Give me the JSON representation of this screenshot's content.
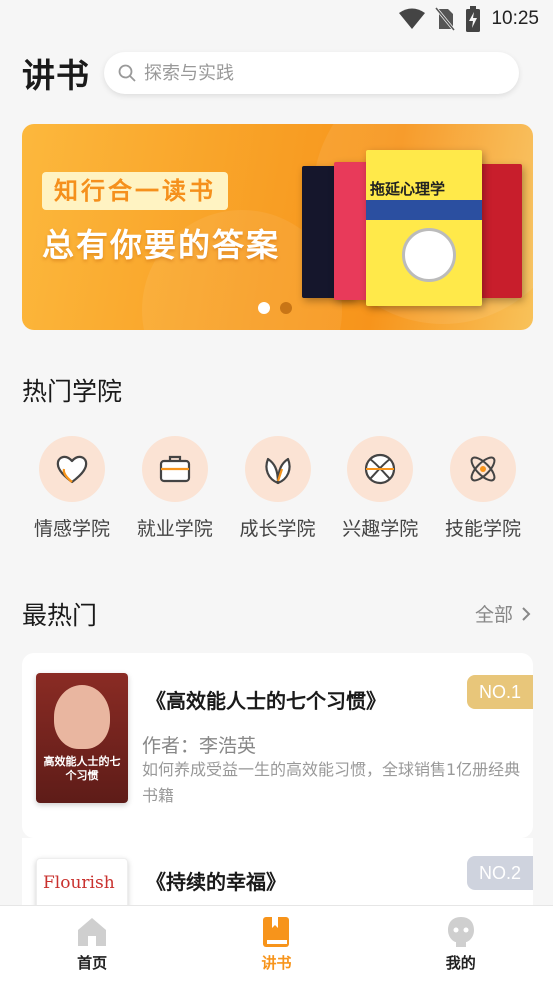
{
  "status_bar": {
    "time": "10:25"
  },
  "header": {
    "title": "讲书",
    "search_placeholder": "探索与实践"
  },
  "banner": {
    "line1": "知行合一读书",
    "line2": "总有你要的答案",
    "book_title": "拖延心理学",
    "slide_count": 2,
    "active_slide": 1
  },
  "hot_academies": {
    "title": "热门学院",
    "items": [
      {
        "label": "情感学院",
        "icon": "heart-icon"
      },
      {
        "label": "就业学院",
        "icon": "briefcase-icon"
      },
      {
        "label": "成长学院",
        "icon": "leaf-icon"
      },
      {
        "label": "兴趣学院",
        "icon": "basketball-icon"
      },
      {
        "label": "技能学院",
        "icon": "atom-icon"
      }
    ]
  },
  "hottest": {
    "title": "最热门",
    "see_all": "全部",
    "books": [
      {
        "title": "《高效能人士的七个习惯》",
        "author": "作者：李浩英",
        "desc": "如何养成受益一生的高效能习惯，全球销售1亿册经典书籍",
        "rank": "NO.1",
        "cover_text": "高效能人士的七个习惯"
      },
      {
        "title": "《持续的幸福》",
        "rank": "NO.2",
        "cover_text": "Flourish"
      }
    ]
  },
  "bottom_nav": [
    {
      "label": "首页",
      "icon": "home-icon"
    },
    {
      "label": "讲书",
      "icon": "book-icon",
      "active": true
    },
    {
      "label": "我的",
      "icon": "profile-icon"
    }
  ],
  "colors": {
    "accent": "#f7941b",
    "rank1": "#e8c67a",
    "rank2": "#cfd3de",
    "academy_bg": "#fbe3d4"
  }
}
